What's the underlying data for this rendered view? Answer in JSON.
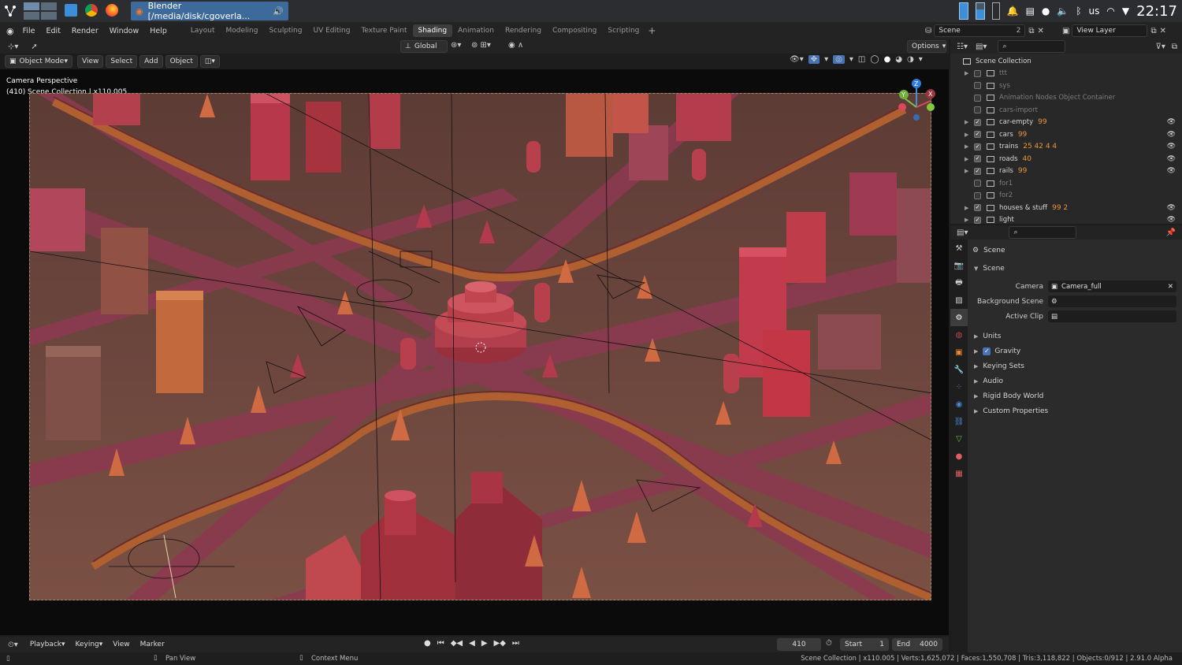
{
  "taskbar": {
    "window_title": "Blender [/media/disk/cgoverla...",
    "keyboard_layout": "us",
    "clock": "22:17"
  },
  "menubar": {
    "items": [
      "File",
      "Edit",
      "Render",
      "Window",
      "Help"
    ],
    "workspaces": [
      "Layout",
      "Modeling",
      "Sculpting",
      "UV Editing",
      "Texture Paint",
      "Shading",
      "Animation",
      "Rendering",
      "Compositing",
      "Scripting"
    ],
    "active_workspace": "Shading",
    "scene_field": "Scene",
    "scene_users": "2",
    "view_layer_field": "View Layer"
  },
  "viewport": {
    "transform_orientation": "Global",
    "options_label": "Options",
    "mode": "Object Mode",
    "menus": [
      "View",
      "Select",
      "Add",
      "Object"
    ],
    "overlay_title": "Camera Perspective",
    "overlay_subtitle": "(410) Scene Collection | x110.005",
    "gizmo_axes": [
      "Z",
      "Y",
      "X"
    ]
  },
  "timeline": {
    "menus": [
      "Playback",
      "Keying",
      "View",
      "Marker"
    ],
    "current_frame": "410",
    "start_label": "Start",
    "start_value": "1",
    "end_label": "End",
    "end_value": "4000"
  },
  "statusbar": {
    "hint_pan": "Pan View",
    "hint_context": "Context Menu",
    "stats": "Scene Collection | x110.005 | Verts:1,625,072 | Faces:1,550,708 | Tris:3,118,822 | Objects:0/912 | 2.91.0 Alpha"
  },
  "outliner": {
    "root": "Scene Collection",
    "rows": [
      {
        "name": "ttt",
        "expand": true,
        "checked": false,
        "dim": true,
        "eye": false,
        "badges": ""
      },
      {
        "name": "sys",
        "expand": false,
        "checked": false,
        "dim": true,
        "eye": false,
        "badges": ""
      },
      {
        "name": "Animation Nodes Object Container",
        "expand": false,
        "checked": false,
        "dim": true,
        "eye": false,
        "badges": ""
      },
      {
        "name": "cars-import",
        "expand": false,
        "checked": false,
        "dim": true,
        "eye": false,
        "badges": ""
      },
      {
        "name": "car-empty",
        "expand": true,
        "checked": true,
        "dim": false,
        "eye": true,
        "badges": "99"
      },
      {
        "name": "cars",
        "expand": true,
        "checked": true,
        "dim": false,
        "eye": true,
        "badges": "99"
      },
      {
        "name": "trains",
        "expand": true,
        "checked": true,
        "dim": false,
        "eye": true,
        "badges": "25 42 4 4"
      },
      {
        "name": "roads",
        "expand": true,
        "checked": true,
        "dim": false,
        "eye": true,
        "badges": "40"
      },
      {
        "name": "rails",
        "expand": true,
        "checked": true,
        "dim": false,
        "eye": true,
        "badges": "99"
      },
      {
        "name": "for1",
        "expand": false,
        "checked": false,
        "dim": true,
        "eye": false,
        "badges": ""
      },
      {
        "name": "for2",
        "expand": false,
        "checked": false,
        "dim": true,
        "eye": false,
        "badges": ""
      },
      {
        "name": "houses & stuff",
        "expand": true,
        "checked": true,
        "dim": false,
        "eye": true,
        "badges": "99 2"
      },
      {
        "name": "light",
        "expand": true,
        "checked": true,
        "dim": false,
        "eye": true,
        "badges": ""
      }
    ]
  },
  "properties": {
    "context": "Scene",
    "panel_title": "Scene",
    "camera_label": "Camera",
    "camera_value": "Camera_full",
    "bg_scene_label": "Background Scene",
    "active_clip_label": "Active Clip",
    "subpanels": [
      "Units",
      "Gravity",
      "Keying Sets",
      "Audio",
      "Rigid Body World",
      "Custom Properties"
    ],
    "gravity_checked": true
  },
  "colors": {
    "ground": "#6e4a40",
    "road": "#8f3b52",
    "building_red": "#b53b45",
    "building_orange": "#c06438",
    "accent_blue": "#4772b3"
  }
}
